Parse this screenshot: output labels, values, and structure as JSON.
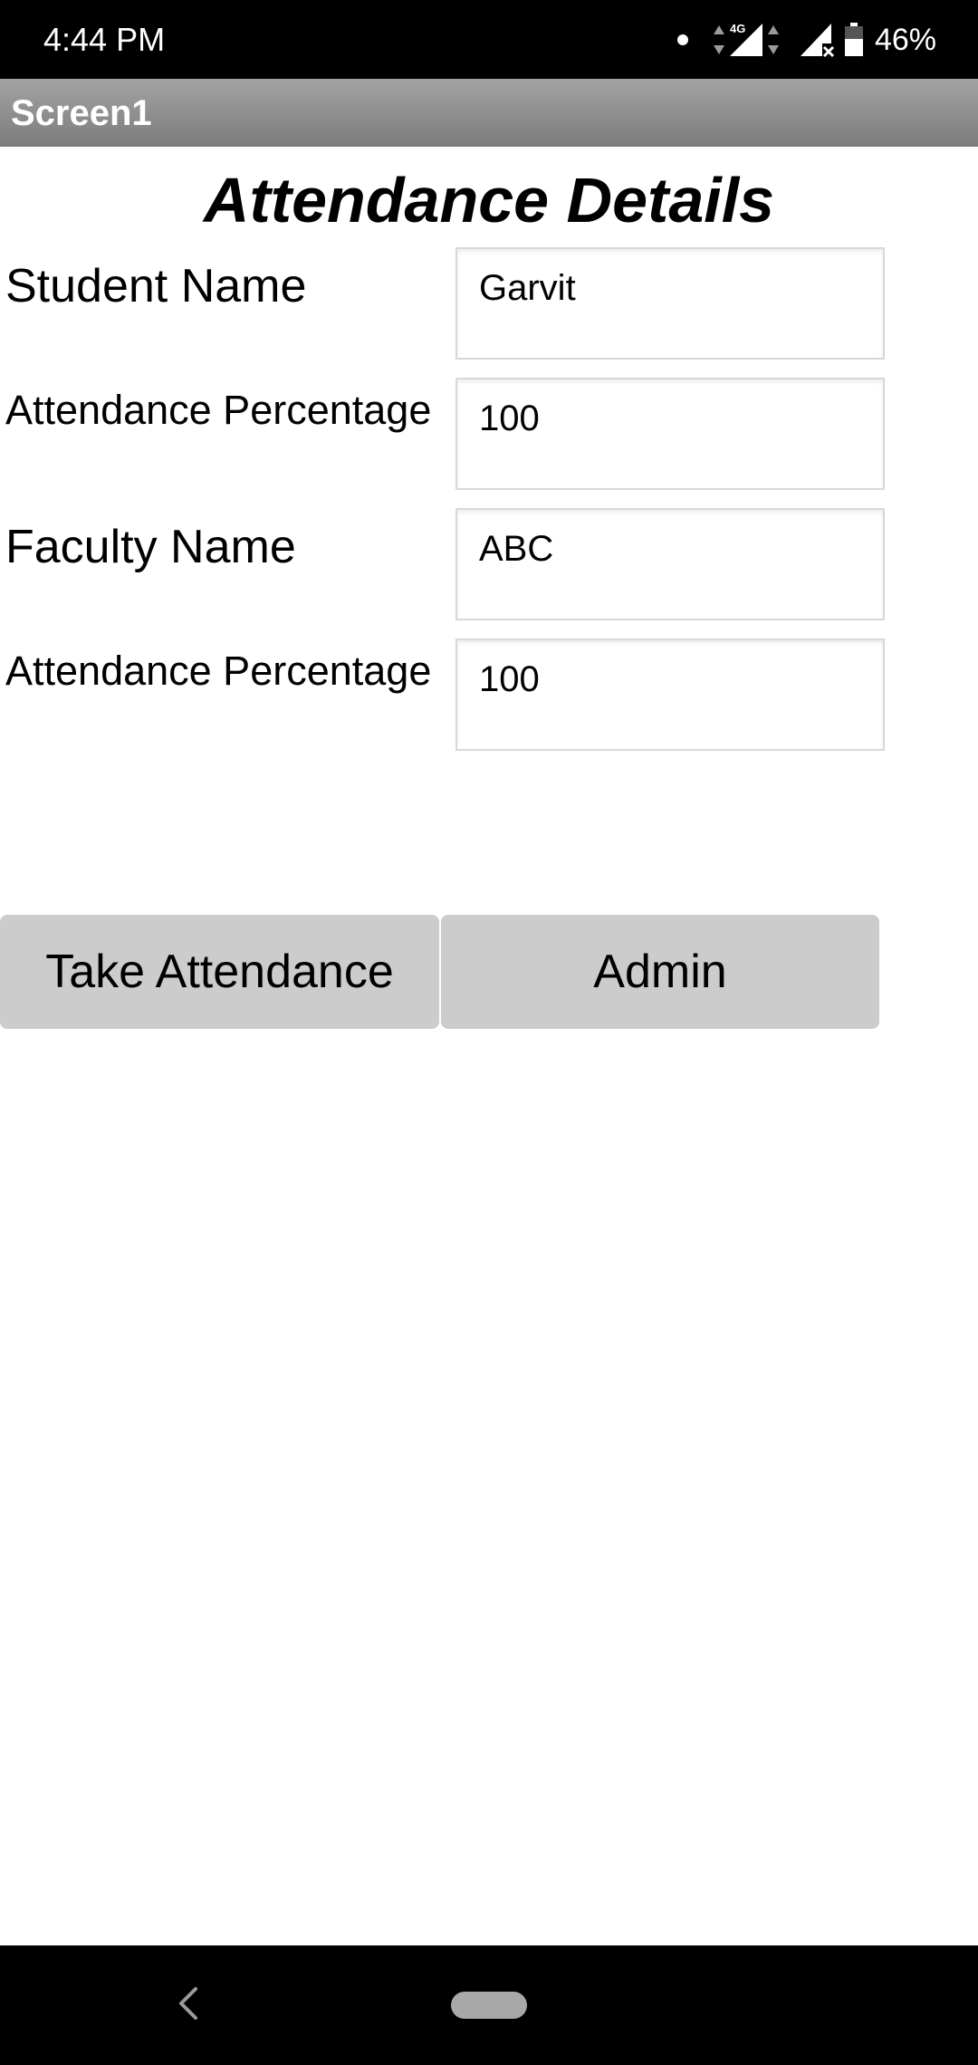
{
  "status_bar": {
    "time": "4:44 PM",
    "network_label": "4G",
    "battery": "46%"
  },
  "app_bar": {
    "title": "Screen1"
  },
  "form": {
    "heading": "Attendance Details",
    "student_name": {
      "label": "Student Name",
      "value": "Garvit"
    },
    "student_attendance": {
      "label": "Attendance Percentage",
      "value": "100"
    },
    "faculty_name": {
      "label": "Faculty Name",
      "value": "ABC"
    },
    "faculty_attendance": {
      "label": "Attendance Percentage",
      "value": "100"
    }
  },
  "buttons": {
    "take_attendance": "Take Attendance",
    "admin": "Admin"
  },
  "colors": {
    "status_bar_bg": "#000000",
    "app_bar_top": "#a3a3a3",
    "app_bar_bottom": "#7c7c7c",
    "button_bg": "#cccccc",
    "content_bg": "#ffffff"
  },
  "icons": {
    "status": [
      "notification-dot-icon",
      "data-arrows-icon",
      "signal-4g-icon",
      "signal-no-sim-icon",
      "battery-icon"
    ],
    "nav": [
      "back-icon",
      "home-pill-icon"
    ]
  }
}
